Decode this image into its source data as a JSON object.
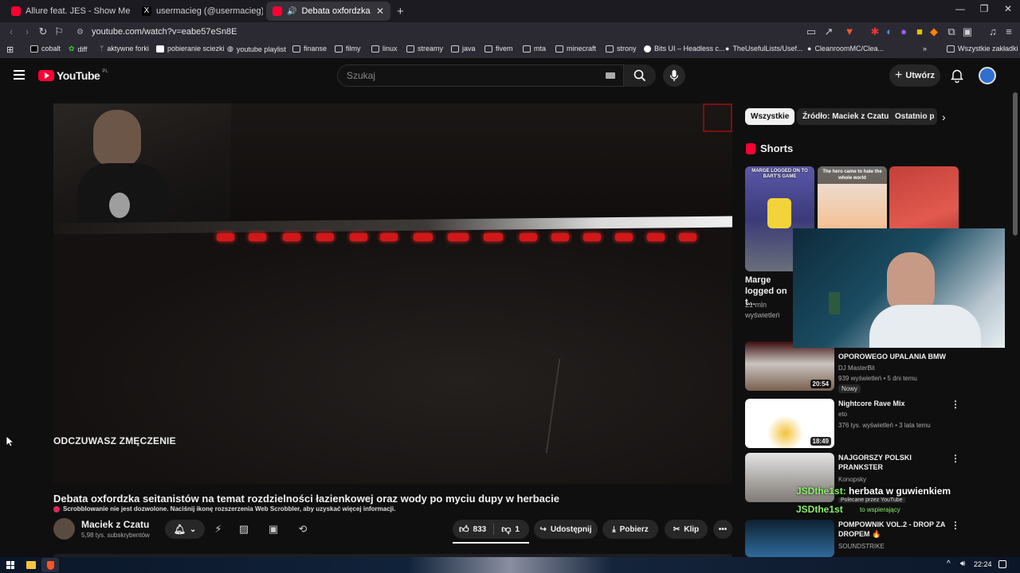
{
  "browser": {
    "tabs": [
      {
        "label": "Allure feat. JES - Show Me the Way (",
        "favicon_color": "#ff0033"
      },
      {
        "label": "usermacieg (@usermacieg) / X",
        "favicon_color": "#000000"
      },
      {
        "label": "Debata oxfordzka seitanistów",
        "favicon_color": "#ff0033"
      }
    ],
    "url": "youtube.com/watch?v=eabe57eSn8E",
    "bookmarks": [
      "cobalt",
      "diff",
      "aktywne forki",
      "pobieranie sciezki",
      "youtube playlist",
      "finanse",
      "filmy",
      "linux",
      "streamy",
      "java",
      "fivem",
      "mta",
      "minecraft",
      "strony",
      "Bits UI – Headless c...",
      "TheUsefulLists/Usef...",
      "CleanroomMC/Clea...",
      "Wszystkie zakładki"
    ]
  },
  "yt": {
    "logo": "YouTube",
    "region": "PL",
    "search_placeholder": "Szukaj",
    "create_label": "Utwórz",
    "accent": "#ff0033"
  },
  "video": {
    "subtitle": "ODCZUWASZ ZMĘCZENIE",
    "title": "Debata oxfordzka seitanistów na temat rozdzielności łazienkowej oraz wody po myciu dupy w herbacie",
    "scrobble_notice": "Scrobblowanie nie jest dozwolone. Naciśnij ikonę rozszerzenia Web Scrobbler, aby uzyskać więcej informacji.",
    "channel": "Maciek z Czatu",
    "subscribers": "5,98 tys. subskrybentów",
    "likes": "833",
    "dislikes": "1",
    "share_label": "Udostępnij",
    "download_label": "Pobierz",
    "clip_label": "Klip"
  },
  "sidebar": {
    "chips": [
      "Wszystkie",
      "Źródło: Maciek z Czatu",
      "Ostatnio p"
    ],
    "shorts_heading": "Shorts",
    "shorts": [
      {
        "thumb_text": "MARGE LOGGED ON TO BART'S GAME",
        "title": "Marge logged on t...",
        "views": "21 mln",
        "views_label": "wyświetleń"
      },
      {
        "thumb_text": "The hero came to hate the whole world"
      },
      {
        "thumb_text": ""
      }
    ],
    "recommended": [
      {
        "title": "OPOROWEGO UPALANIA BMW",
        "channel": "DJ MasterBit",
        "meta": "939 wyświetleń • 5 dni temu",
        "badge": "Nowy",
        "duration": "20:54"
      },
      {
        "title": "Nightcore Rave Mix",
        "channel": "eto",
        "meta": "376 tys. wyświetleń • 3 lata temu",
        "duration": "18:49"
      },
      {
        "title": "NAJGORSZY POLSKI PRANKSTER",
        "channel": "Konopsky",
        "meta": "Polecane przez YouTube",
        "duration": ""
      },
      {
        "title": "POMPOWNIK VOL.2 - DROP ZA DROPEM 🔥",
        "channel": "SOUNDSTRIKE",
        "meta": "",
        "duration": ""
      }
    ]
  },
  "overlay": {
    "chat_user": "JSDthe1st:",
    "chat_message": " herbata w guwienkiem",
    "chat_user2": "JSDthe1st",
    "chat_support": "to wspierający"
  },
  "taskbar": {
    "time": "22:24"
  }
}
